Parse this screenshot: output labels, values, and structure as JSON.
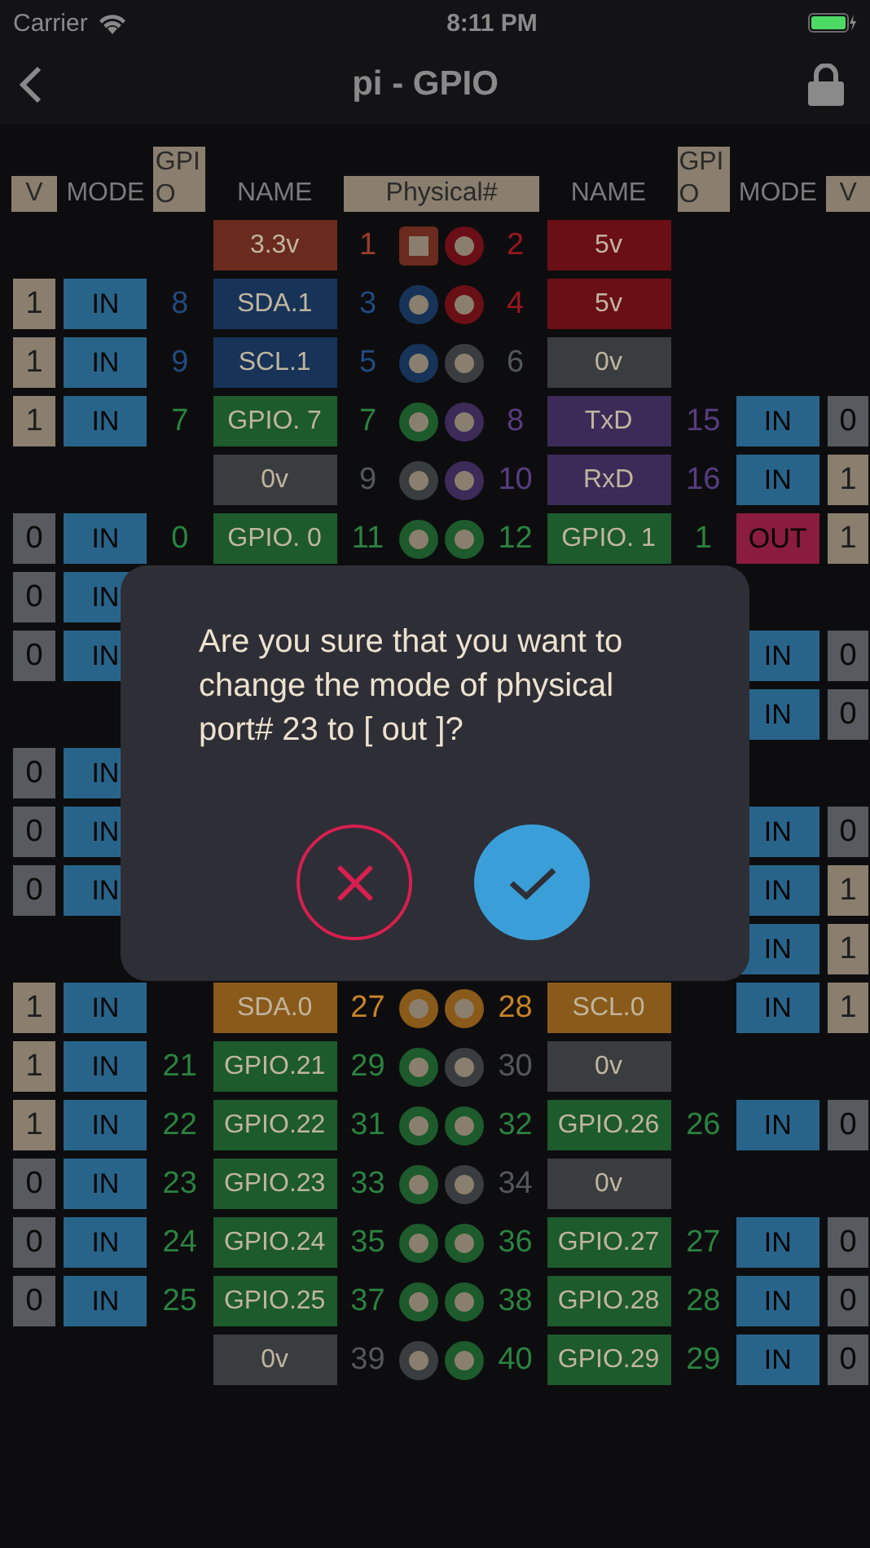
{
  "status_bar": {
    "carrier": "Carrier",
    "time": "8:11 PM"
  },
  "nav": {
    "title": "pi - GPIO"
  },
  "columns": {
    "left": [
      {
        "label": "V",
        "boxed": true
      },
      {
        "label": "MODE",
        "boxed": false
      },
      {
        "label": "GPIO",
        "boxed": true
      },
      {
        "label": "NAME",
        "boxed": false
      }
    ],
    "center": {
      "label": "Physical#",
      "boxed": true
    },
    "right": [
      {
        "label": "NAME",
        "boxed": false
      },
      {
        "label": "GPIO",
        "boxed": true
      },
      {
        "label": "MODE",
        "boxed": false
      },
      {
        "label": "V",
        "boxed": true
      }
    ]
  },
  "rows": [
    {
      "left": {
        "name": "3.3v",
        "color": "#6a2a1e",
        "pin": "1",
        "kind": "square"
      },
      "right": {
        "name": "5v",
        "color": "#6b0f16",
        "pin": "2",
        "kind": "round"
      }
    },
    {
      "left": {
        "v": {
          "label": "1",
          "high": true
        },
        "mode": {
          "label": "IN",
          "out": false
        },
        "gpio": "8",
        "name": "SDA.1",
        "color": "#173358",
        "pin": "3",
        "kind": "round"
      },
      "right": {
        "name": "5v",
        "color": "#6b0f16",
        "pin": "4",
        "kind": "round"
      }
    },
    {
      "left": {
        "v": {
          "label": "1",
          "high": true
        },
        "mode": {
          "label": "IN",
          "out": false
        },
        "gpio": "9",
        "name": "SCL.1",
        "color": "#173358",
        "pin": "5",
        "kind": "round"
      },
      "right": {
        "name": "0v",
        "color": "#3a3d40",
        "pin": "6",
        "kind": "round"
      }
    },
    {
      "left": {
        "v": {
          "label": "1",
          "high": true
        },
        "mode": {
          "label": "IN",
          "out": false
        },
        "gpio": "7",
        "name": "GPIO. 7",
        "color": "#1d5a2c",
        "pin": "7",
        "kind": "round"
      },
      "right": {
        "name": "TxD",
        "color": "#3c2a58",
        "pin": "8",
        "kind": "round",
        "gpio": "15",
        "mode": {
          "label": "IN",
          "out": false
        },
        "v": {
          "label": "0",
          "high": false
        }
      }
    },
    {
      "left": {
        "name": "0v",
        "color": "#3a3d40",
        "pin": "9",
        "kind": "round"
      },
      "right": {
        "name": "RxD",
        "color": "#3c2a58",
        "pin": "10",
        "kind": "round",
        "gpio": "16",
        "mode": {
          "label": "IN",
          "out": false
        },
        "v": {
          "label": "1",
          "high": true
        }
      }
    },
    {
      "left": {
        "v": {
          "label": "0",
          "high": false
        },
        "mode": {
          "label": "IN",
          "out": false
        },
        "gpio": "0",
        "name": "GPIO. 0",
        "color": "#1d5a2c",
        "pin": "11",
        "kind": "round"
      },
      "right": {
        "name": "GPIO. 1",
        "color": "#1d5a2c",
        "pin": "12",
        "kind": "round",
        "gpio": "1",
        "mode": {
          "label": "OUT",
          "out": true
        },
        "v": {
          "label": "1",
          "high": true
        }
      }
    },
    {
      "left": {
        "v": {
          "label": "0",
          "high": false
        },
        "mode": {
          "label": "IN",
          "out": false
        }
      },
      "right": {}
    },
    {
      "left": {
        "v": {
          "label": "0",
          "high": false
        },
        "mode": {
          "label": "IN",
          "out": false
        }
      },
      "right": {
        "mode": {
          "label": "IN",
          "out": false
        },
        "v": {
          "label": "0",
          "high": false
        }
      }
    },
    {
      "left": {},
      "right": {
        "mode": {
          "label": "IN",
          "out": false
        },
        "v": {
          "label": "0",
          "high": false
        }
      }
    },
    {
      "left": {
        "v": {
          "label": "0",
          "high": false
        },
        "mode": {
          "label": "IN",
          "out": false
        }
      },
      "right": {}
    },
    {
      "left": {
        "v": {
          "label": "0",
          "high": false
        },
        "mode": {
          "label": "IN",
          "out": false
        }
      },
      "right": {
        "mode": {
          "label": "IN",
          "out": false
        },
        "v": {
          "label": "0",
          "high": false
        }
      }
    },
    {
      "left": {
        "v": {
          "label": "0",
          "high": false
        },
        "mode": {
          "label": "IN",
          "out": false
        }
      },
      "right": {
        "mode": {
          "label": "IN",
          "out": false
        },
        "v": {
          "label": "1",
          "high": true
        }
      }
    },
    {
      "left": {},
      "right": {
        "mode": {
          "label": "IN",
          "out": false
        },
        "v": {
          "label": "1",
          "high": true
        }
      }
    },
    {
      "left": {
        "v": {
          "label": "1",
          "high": true
        },
        "mode": {
          "label": "IN",
          "out": false
        },
        "name": "SDA.0",
        "color": "#8a5a1a",
        "pin": "27",
        "kind": "round"
      },
      "right": {
        "name": "SCL.0",
        "color": "#8a5a1a",
        "pin": "28",
        "kind": "round",
        "mode": {
          "label": "IN",
          "out": false
        },
        "v": {
          "label": "1",
          "high": true
        }
      }
    },
    {
      "left": {
        "v": {
          "label": "1",
          "high": true
        },
        "mode": {
          "label": "IN",
          "out": false
        },
        "gpio": "21",
        "name": "GPIO.21",
        "color": "#1d5a2c",
        "pin": "29",
        "kind": "round"
      },
      "right": {
        "name": "0v",
        "color": "#3a3d40",
        "pin": "30",
        "kind": "round"
      }
    },
    {
      "left": {
        "v": {
          "label": "1",
          "high": true
        },
        "mode": {
          "label": "IN",
          "out": false
        },
        "gpio": "22",
        "name": "GPIO.22",
        "color": "#1d5a2c",
        "pin": "31",
        "kind": "round"
      },
      "right": {
        "name": "GPIO.26",
        "color": "#1d5a2c",
        "pin": "32",
        "kind": "round",
        "gpio": "26",
        "mode": {
          "label": "IN",
          "out": false
        },
        "v": {
          "label": "0",
          "high": false
        }
      }
    },
    {
      "left": {
        "v": {
          "label": "0",
          "high": false
        },
        "mode": {
          "label": "IN",
          "out": false
        },
        "gpio": "23",
        "name": "GPIO.23",
        "color": "#1d5a2c",
        "pin": "33",
        "kind": "round"
      },
      "right": {
        "name": "0v",
        "color": "#3a3d40",
        "pin": "34",
        "kind": "round"
      }
    },
    {
      "left": {
        "v": {
          "label": "0",
          "high": false
        },
        "mode": {
          "label": "IN",
          "out": false
        },
        "gpio": "24",
        "name": "GPIO.24",
        "color": "#1d5a2c",
        "pin": "35",
        "kind": "round"
      },
      "right": {
        "name": "GPIO.27",
        "color": "#1d5a2c",
        "pin": "36",
        "kind": "round",
        "gpio": "27",
        "mode": {
          "label": "IN",
          "out": false
        },
        "v": {
          "label": "0",
          "high": false
        }
      }
    },
    {
      "left": {
        "v": {
          "label": "0",
          "high": false
        },
        "mode": {
          "label": "IN",
          "out": false
        },
        "gpio": "25",
        "name": "GPIO.25",
        "color": "#1d5a2c",
        "pin": "37",
        "kind": "round"
      },
      "right": {
        "name": "GPIO.28",
        "color": "#1d5a2c",
        "pin": "38",
        "kind": "round",
        "gpio": "28",
        "mode": {
          "label": "IN",
          "out": false
        },
        "v": {
          "label": "0",
          "high": false
        }
      }
    },
    {
      "left": {
        "name": "0v",
        "color": "#3a3d40",
        "pin": "39",
        "kind": "round"
      },
      "right": {
        "name": "GPIO.29",
        "color": "#1d5a2c",
        "pin": "40",
        "kind": "round",
        "gpio": "29",
        "mode": {
          "label": "IN",
          "out": false
        },
        "v": {
          "label": "0",
          "high": false
        }
      }
    }
  ],
  "dialog": {
    "message": "Are you sure that you want to change the mode of physical port# 23 to [ out ]?"
  }
}
